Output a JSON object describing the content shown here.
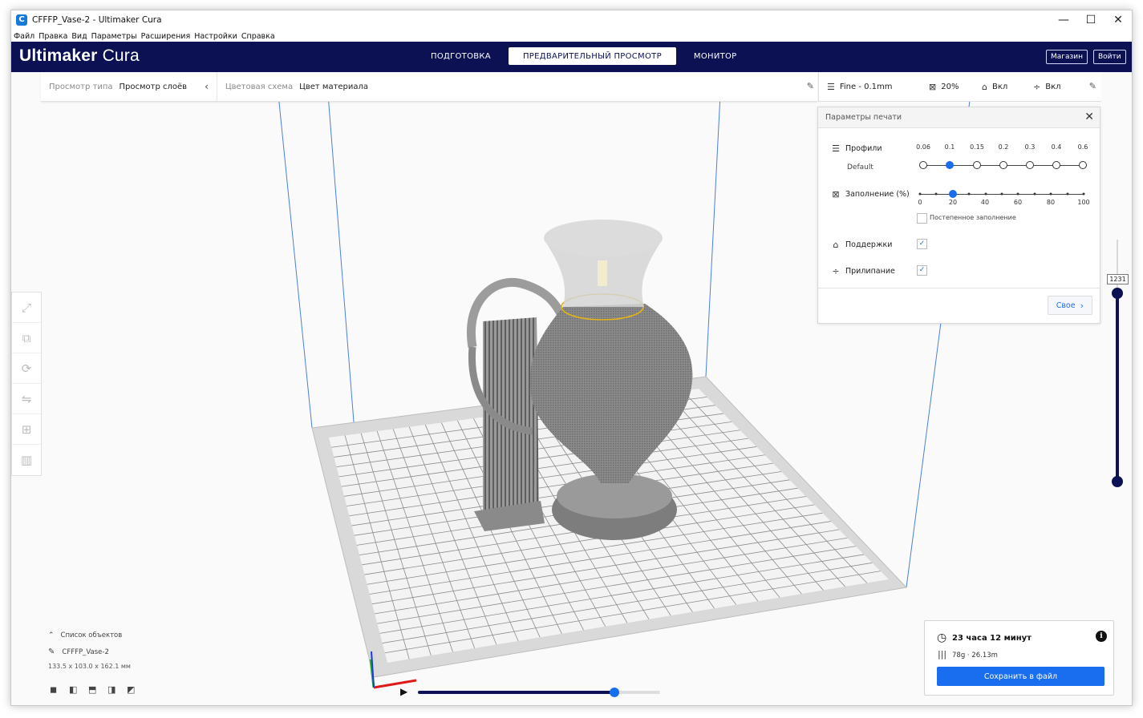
{
  "window": {
    "title": "CFFFP_Vase-2 - Ultimaker Cura",
    "controls": [
      "—",
      "☐",
      "✕"
    ]
  },
  "menubar": [
    "Файл",
    "Правка",
    "Вид",
    "Параметры",
    "Расширения",
    "Настройки",
    "Справка"
  ],
  "header": {
    "brand_bold": "Ultimaker",
    "brand_light": "Cura",
    "tabs": [
      "ПОДГОТОВКА",
      "ПРЕДВАРИТЕЛЬНЫЙ ПРОСМОТР",
      "МОНИТОР"
    ],
    "active_tab": "ПРЕДВАРИТЕЛЬНЫЙ ПРОСМОТР",
    "marketplace": "Магазин",
    "signin": "Войти"
  },
  "viewbar": {
    "view_type_label": "Просмотр типа",
    "view_type_value": "Просмотр слоёв",
    "color_scheme_label": "Цветовая схема",
    "color_scheme_value": "Цвет материала"
  },
  "print_summary": {
    "profile": "Fine - 0.1mm",
    "infill": "20%",
    "support": "Вкл",
    "adhesion": "Вкл"
  },
  "print_panel": {
    "title": "Параметры печати",
    "profiles_label": "Профили",
    "profile_default": "Default",
    "profile_ticks": [
      "0.06",
      "0.1",
      "0.15",
      "0.2",
      "0.3",
      "0.4",
      "0.6"
    ],
    "profile_selected_index": 1,
    "infill_label": "Заполнение (%)",
    "infill_ticks": [
      "0",
      "20",
      "40",
      "60",
      "80",
      "100"
    ],
    "infill_value": 20,
    "gradual_infill": "Постепенное заполнение",
    "supports_label": "Поддержки",
    "supports_checked": true,
    "adhesion_label": "Прилипание",
    "adhesion_checked": true,
    "custom_button": "Свое"
  },
  "layer_slider": {
    "current_layer": "1231"
  },
  "object_list": {
    "title": "Список объектов",
    "object_name": "CFFFP_Vase-2",
    "dimensions": "133.5 x 103.0 x 162.1 мм"
  },
  "playback": {
    "progress": 0.81
  },
  "estimate": {
    "time": "23 часа 12 минут",
    "material": "78g · 26.13m",
    "save_button": "Сохранить в файл"
  },
  "colors": {
    "header_bg": "#0b1152",
    "accent": "#196ef0",
    "model_gray": "#7a7a7a",
    "layer_yellow": "#e3b21a"
  }
}
